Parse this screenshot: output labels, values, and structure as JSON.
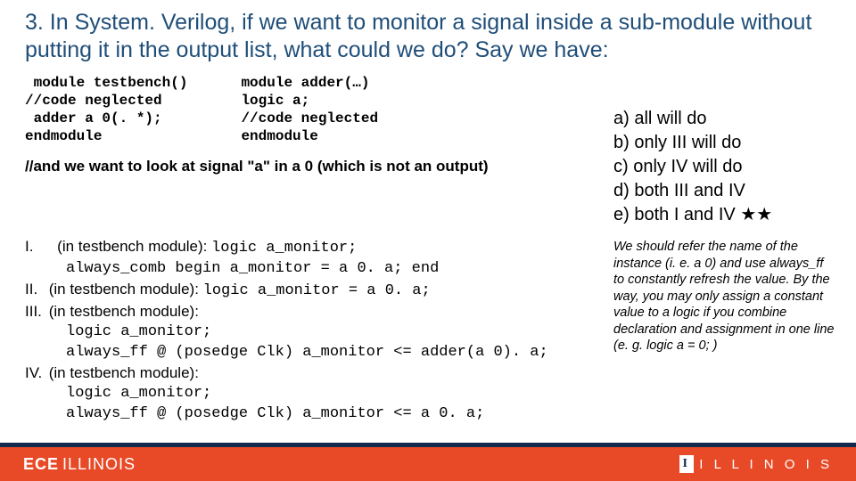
{
  "title": "3. In System. Verilog, if we want to monitor a signal inside a sub-module without putting it in the output list, what could we do? Say we have:",
  "codeLeft": {
    "l1": " module testbench()",
    "l2": "//code neglected",
    "l3": " adder a 0(. *);",
    "l4": "endmodule"
  },
  "codeRight": {
    "l1": "module adder(…)",
    "l2": "logic a;",
    "l3": "//code neglected",
    "l4": "endmodule"
  },
  "note": "//and we want to look at signal \"a\" in a 0 (which is not an output)",
  "answers": {
    "i_label": "I.",
    "i_text_a": "(in testbench module): ",
    "i_code_a": "logic a_monitor;",
    "i_code_b": "always_comb begin a_monitor = a 0. a; end",
    "ii_label": "II.",
    "ii_text": " (in testbench module): ",
    "ii_code": "logic a_monitor = a 0. a;",
    "iii_label": "III.",
    "iii_text": " (in testbench module):",
    "iii_code_a": "logic a_monitor;",
    "iii_code_b": "always_ff @ (posedge Clk) a_monitor <= adder(a 0). a;",
    "iv_label": "IV.",
    "iv_text": " (in testbench module):",
    "iv_code_a": "logic a_monitor;",
    "iv_code_b": "always_ff @ (posedge Clk) a_monitor <= a 0. a;"
  },
  "choices": {
    "a": "a) all will do",
    "b": "b) only III will do",
    "c": "c) only IV will do",
    "d": "d) both III and IV",
    "e": "e) both I and IV ★★"
  },
  "explain": "We should refer the name of the instance (i. e. a 0) and use always_ff to constantly refresh the value. By the way, you may only assign a constant value to a logic if you combine declaration and assignment in one line (e. g. logic a = 0; )",
  "footer": {
    "left_a": "ECE",
    "left_b": "ILLINOIS",
    "right_i": "I",
    "right_text": "I L L I N O I S"
  }
}
